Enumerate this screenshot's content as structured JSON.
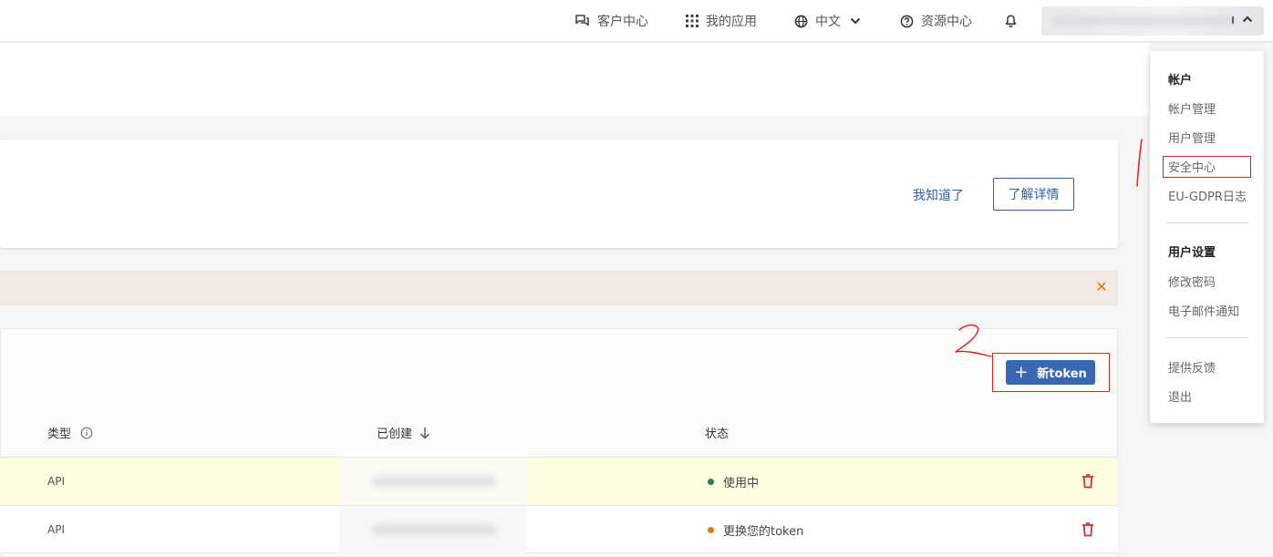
{
  "topbar": {
    "customer_center": "客户中心",
    "my_apps": "我的应用",
    "language": "中文",
    "resource_center": "资源中心"
  },
  "info_card": {
    "got_it": "我知道了",
    "learn_more": "了解详情"
  },
  "warning_banner": {
    "close_icon": "close-icon",
    "accent_color": "#e07b13"
  },
  "token_panel": {
    "new_token_plus": "+",
    "new_token_label": "新token",
    "columns": {
      "type": "类型",
      "created": "已创建",
      "status": "状态"
    },
    "rows": [
      {
        "type": "API",
        "status": "使用中",
        "status_color": "#2e7d4f"
      },
      {
        "type": "API",
        "status": "更换您的token",
        "status_color": "#e07b13"
      }
    ]
  },
  "dropdown": {
    "account_section": "帐户",
    "account_items": [
      "帐户管理",
      "用户管理",
      "安全中心",
      "EU-GDPR日志"
    ],
    "user_settings_section": "用户设置",
    "user_settings_items": [
      "修改密码",
      "电子邮件通知"
    ],
    "other_items": [
      "提供反馈",
      "退出"
    ]
  },
  "annotations": {
    "mark_1": "1",
    "mark_2": "2",
    "color": "#e02020"
  },
  "colors": {
    "primary": "#3867b4",
    "link": "#2d5fa8",
    "danger": "#d0303a",
    "row_highlight": "#fcfce0"
  }
}
